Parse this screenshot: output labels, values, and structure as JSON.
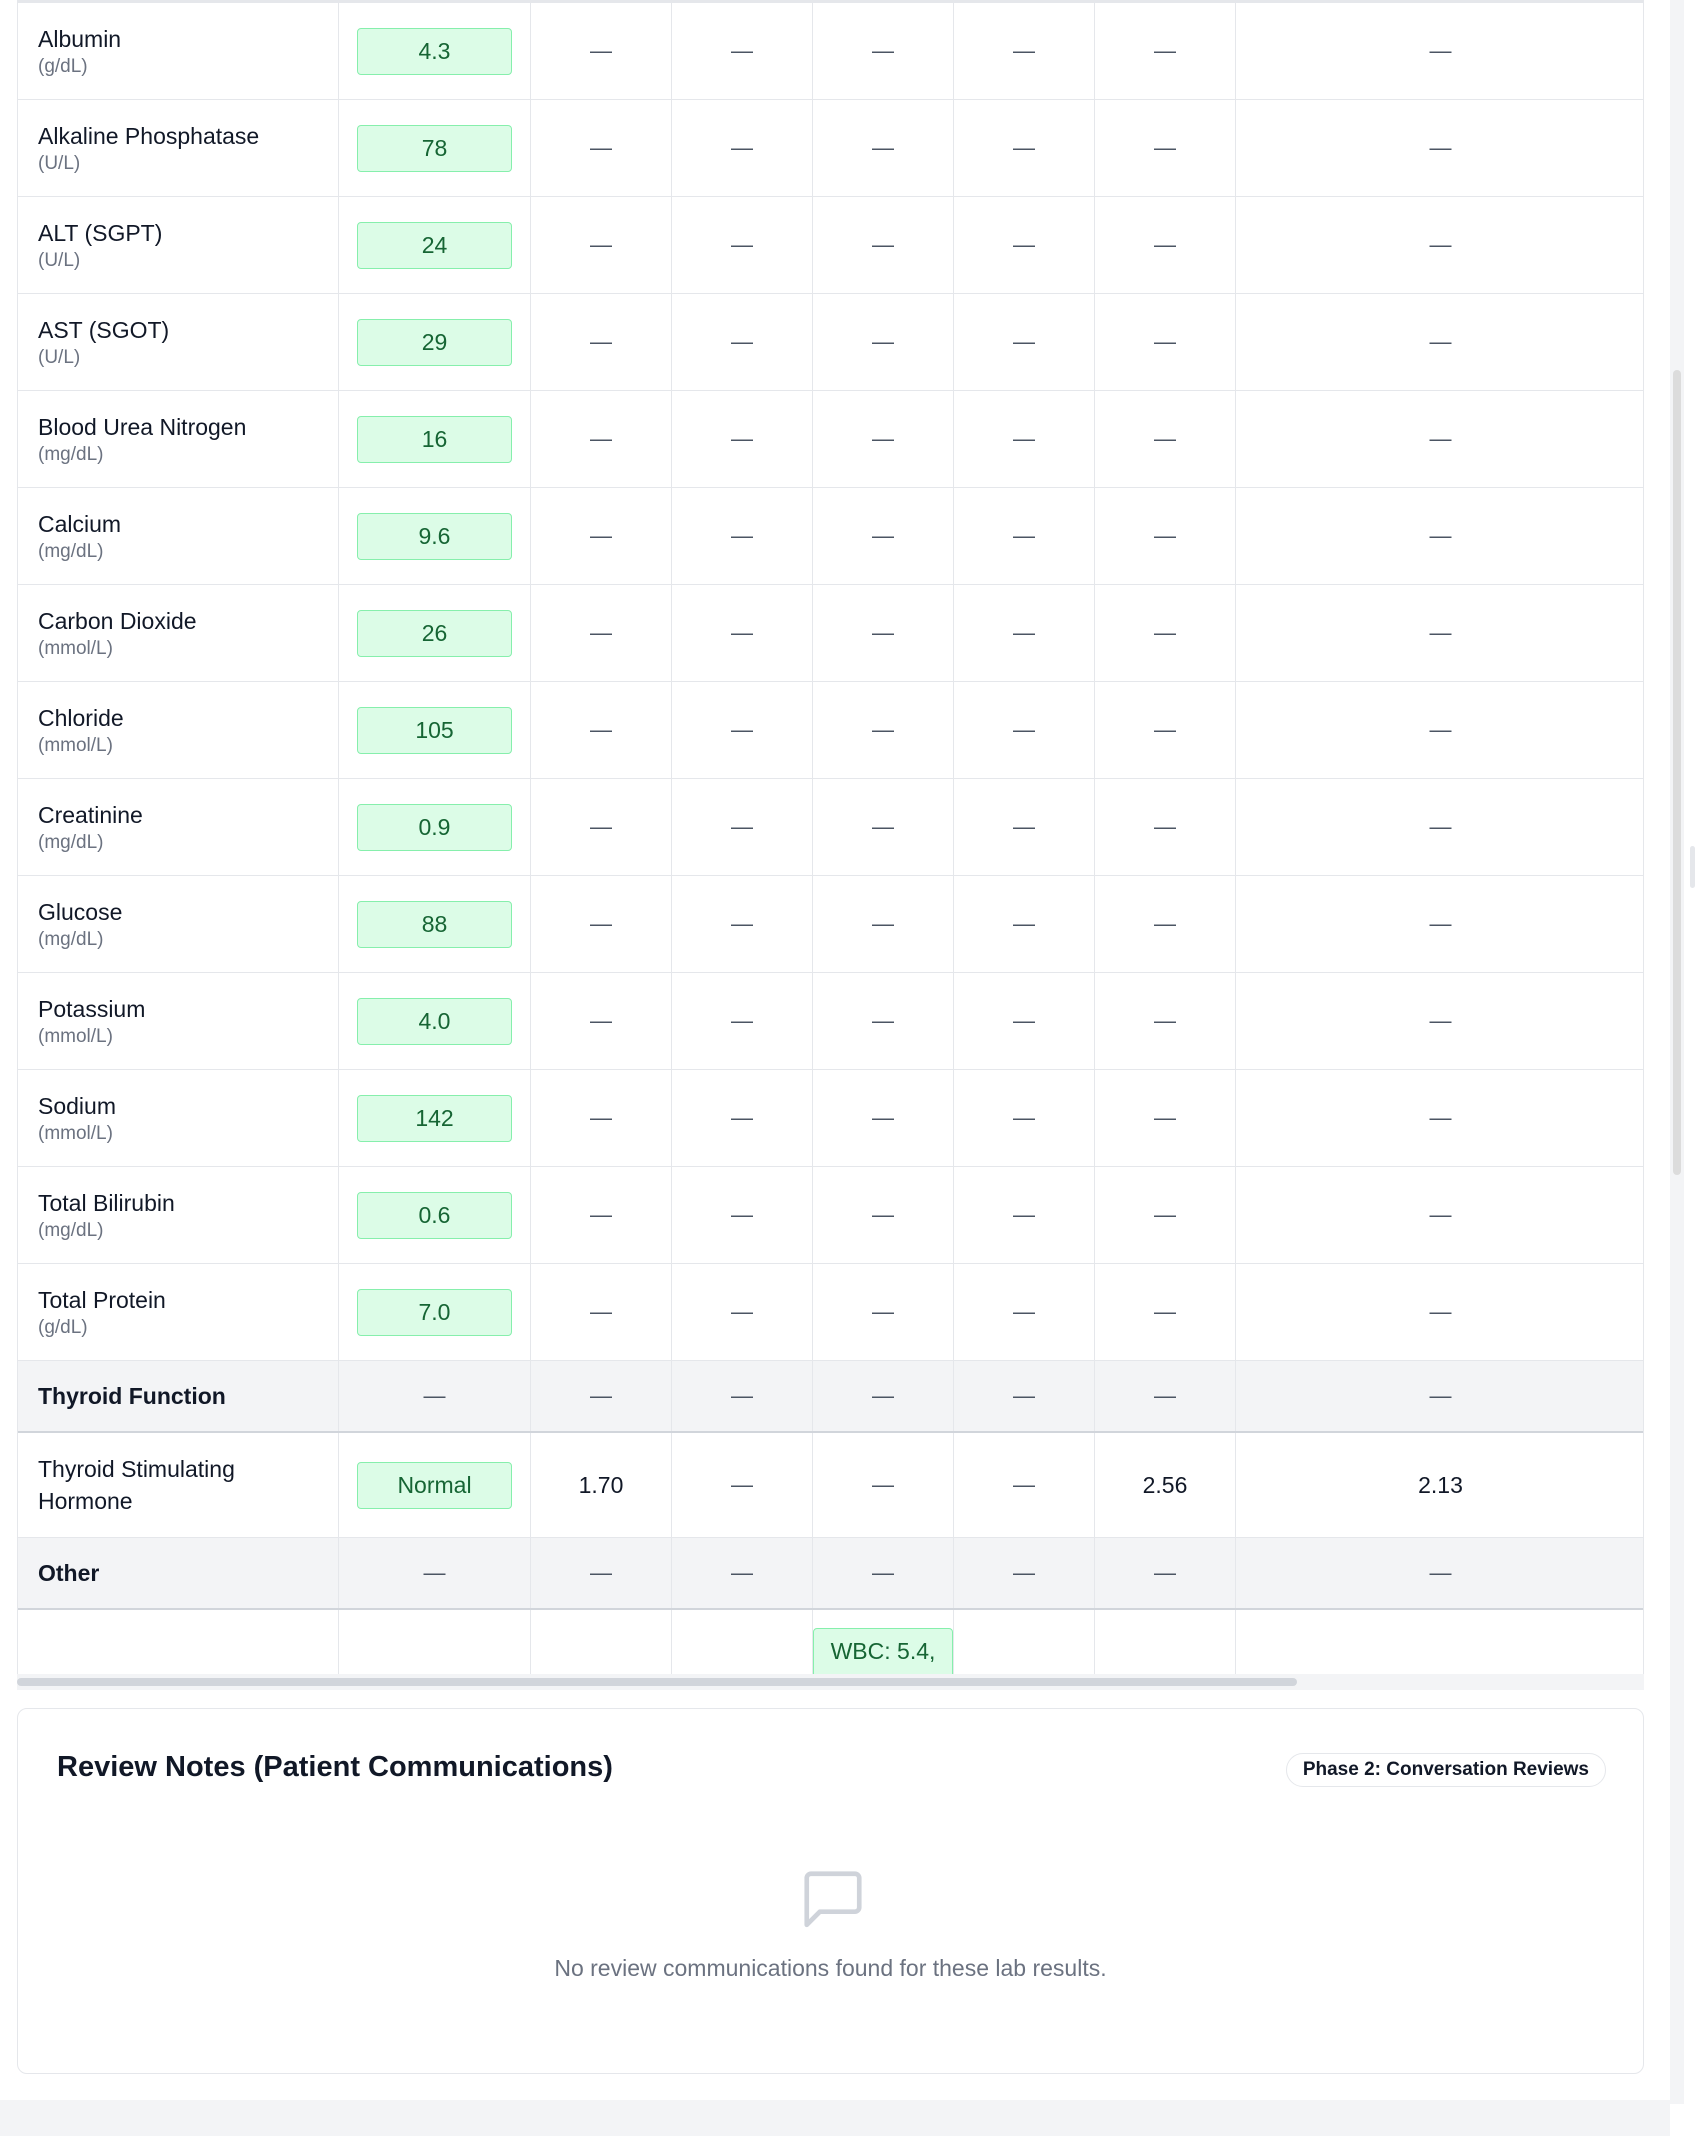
{
  "table": {
    "lab_rows_top": [
      {
        "name": "Albumin",
        "unit": "(g/dL)",
        "value": "4.3",
        "cols": [
          "—",
          "—",
          "—",
          "—",
          "—",
          "—"
        ]
      },
      {
        "name": "Alkaline Phosphatase",
        "unit": "(U/L)",
        "value": "78",
        "cols": [
          "—",
          "—",
          "—",
          "—",
          "—",
          "—"
        ]
      },
      {
        "name": "ALT (SGPT)",
        "unit": "(U/L)",
        "value": "24",
        "cols": [
          "—",
          "—",
          "—",
          "—",
          "—",
          "—"
        ]
      },
      {
        "name": "AST (SGOT)",
        "unit": "(U/L)",
        "value": "29",
        "cols": [
          "—",
          "—",
          "—",
          "—",
          "—",
          "—"
        ]
      },
      {
        "name": "Blood Urea Nitrogen",
        "unit": "(mg/dL)",
        "value": "16",
        "cols": [
          "—",
          "—",
          "—",
          "—",
          "—",
          "—"
        ]
      },
      {
        "name": "Calcium",
        "unit": "(mg/dL)",
        "value": "9.6",
        "cols": [
          "—",
          "—",
          "—",
          "—",
          "—",
          "—"
        ]
      },
      {
        "name": "Carbon Dioxide",
        "unit": "(mmol/L)",
        "value": "26",
        "cols": [
          "—",
          "—",
          "—",
          "—",
          "—",
          "—"
        ]
      },
      {
        "name": "Chloride",
        "unit": "(mmol/L)",
        "value": "105",
        "cols": [
          "—",
          "—",
          "—",
          "—",
          "—",
          "—"
        ]
      },
      {
        "name": "Creatinine",
        "unit": "(mg/dL)",
        "value": "0.9",
        "cols": [
          "—",
          "—",
          "—",
          "—",
          "—",
          "—"
        ]
      },
      {
        "name": "Glucose",
        "unit": "(mg/dL)",
        "value": "88",
        "cols": [
          "—",
          "—",
          "—",
          "—",
          "—",
          "—"
        ]
      },
      {
        "name": "Potassium",
        "unit": "(mmol/L)",
        "value": "4.0",
        "cols": [
          "—",
          "—",
          "—",
          "—",
          "—",
          "—"
        ]
      },
      {
        "name": "Sodium",
        "unit": "(mmol/L)",
        "value": "142",
        "cols": [
          "—",
          "—",
          "—",
          "—",
          "—",
          "—"
        ]
      },
      {
        "name": "Total Bilirubin",
        "unit": "(mg/dL)",
        "value": "0.6",
        "cols": [
          "—",
          "—",
          "—",
          "—",
          "—",
          "—"
        ]
      },
      {
        "name": "Total Protein",
        "unit": "(g/dL)",
        "value": "7.0",
        "cols": [
          "—",
          "—",
          "—",
          "—",
          "—",
          "—"
        ]
      }
    ],
    "thyroid_section": {
      "title": "Thyroid Function",
      "cols": [
        "—",
        "—",
        "—",
        "—",
        "—",
        "—",
        "—"
      ]
    },
    "tsh_row": {
      "name_line1": "Thyroid Stimulating",
      "name_line2": "Hormone",
      "value": "Normal",
      "cols": [
        "1.70",
        "—",
        "—",
        "—",
        "2.56",
        "2.13"
      ]
    },
    "other_section": {
      "title": "Other",
      "cols": [
        "—",
        "—",
        "—",
        "—",
        "—",
        "—",
        "—"
      ]
    },
    "partial_row": {
      "pill": "WBC: 5.4,"
    }
  },
  "review": {
    "title": "Review Notes (Patient Communications)",
    "badge": "Phase 2: Conversation Reviews",
    "empty_icon": "message-square-icon",
    "empty_text": "No review communications found for these lab results."
  },
  "colors": {
    "pill_bg": "#dcfce7",
    "pill_border": "#86efac",
    "pill_text": "#166534",
    "section_bg": "#f3f4f6"
  }
}
